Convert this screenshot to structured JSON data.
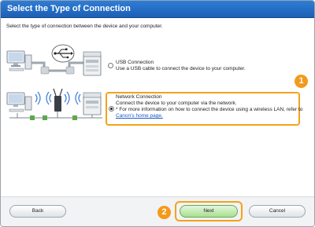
{
  "window": {
    "title": "Select the Type of Connection"
  },
  "subtitle": "Select the type of connection between the device and your computer.",
  "options": {
    "usb": {
      "title": "USB Connection",
      "description": "Use a USB cable to connect the device to your computer.",
      "selected": false
    },
    "network": {
      "title": "Network Connection",
      "line1": "Connect the device to your computer via the network.",
      "line2": "* For more information on how to connect the device using a wireless LAN, refer to",
      "link": "Canon's home page.",
      "selected": true
    }
  },
  "steps": {
    "one": "1",
    "two": "2"
  },
  "buttons": {
    "back": "Back",
    "next": "Next",
    "cancel": "Cancel"
  },
  "colors": {
    "title_bar": "#1d5fb4",
    "highlight": "#f4a21a",
    "next_button": "#a8df8f",
    "link": "#1b58c8"
  }
}
